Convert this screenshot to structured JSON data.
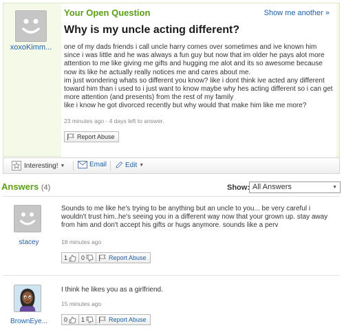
{
  "question": {
    "section_label": "Your Open Question",
    "show_another": "Show me another »",
    "title": "Why is my uncle acting different?",
    "body": "one of my dads friends i call uncle harry comes over sometimes and ive known him since i was little and he was always a fun guy but now that im older he pays alot more attention to me like giving me gifts and hugging me alot and its so awesome because now its like he actually really notices me and cares about me.\nim just wondering whats so different you know? like i dont think ive acted any different toward him than i used to i just want to know maybe why hes acting different so i can get more attention (and presents) from the rest of my family\nlike i know he got divorced recently but why would that make him like me more?",
    "meta": "23 minutes ago - 4 days left to answer.",
    "report_abuse": "Report Abuse",
    "user": "xoxoKimm..."
  },
  "actions": {
    "interesting": "Interesting!",
    "email": "Email",
    "edit": "Edit"
  },
  "answers_header": {
    "title": "Answers",
    "count": "(4)",
    "show_label": "Show:",
    "show_value": "All Answers"
  },
  "answers": [
    {
      "user": "stacey",
      "text": "Sounds to me like he's trying to be anything but an uncle to you... be very careful i wouldn't trust him..he's seeing you in a different way now that your grown up. stay away from him and don't accept his gifts or hugs anymore. sounds like a perv",
      "meta": "18 minutes ago",
      "thumbs_up": "1",
      "thumbs_down": "0",
      "report_abuse": "Report Abuse"
    },
    {
      "user": "BrownEye...",
      "text": "I think he likes you as a girlfriend.",
      "meta": "15 minutes ago",
      "thumbs_up": "0",
      "thumbs_down": "1",
      "report_abuse": "Report Abuse"
    }
  ],
  "colors": {
    "accent_green": "#5a9e14",
    "link_blue": "#1d5fa8",
    "question_bg": "#f4f9e8"
  }
}
